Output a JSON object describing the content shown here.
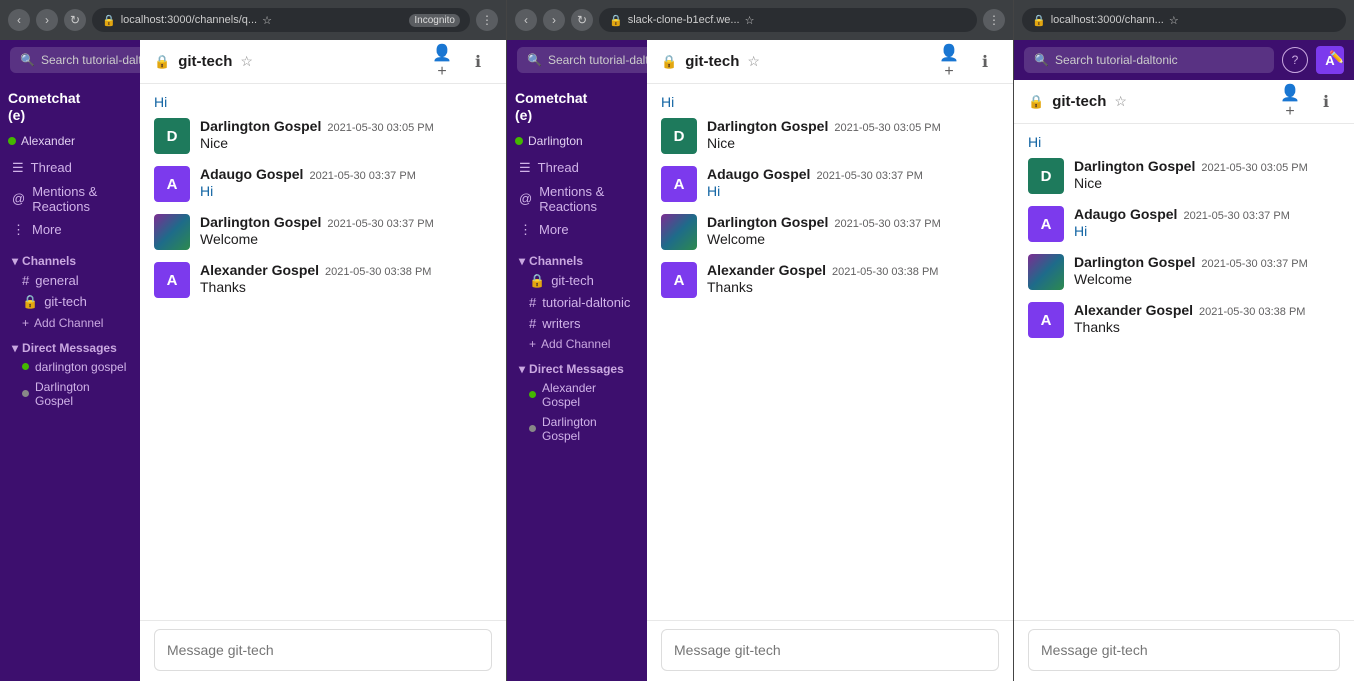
{
  "browsers": [
    {
      "id": "browser1",
      "address": "localhost:3000/channels/q...",
      "badge": "Incognito",
      "app": {
        "brand": "Cometchat (e)",
        "user": "Alexander",
        "search_placeholder": "Search tutorial-daltonic",
        "channel_name": "git-tech",
        "sidebar": {
          "nav_items": [
            {
              "id": "thread",
              "label": "Thread",
              "icon": "☰"
            },
            {
              "id": "mentions",
              "label": "Mentions & Reactions",
              "icon": "@"
            },
            {
              "id": "more",
              "label": "More",
              "icon": "⋮"
            }
          ],
          "channels_section": "Channels",
          "channels": [
            {
              "id": "general",
              "label": "general",
              "icon": "#"
            },
            {
              "id": "git-tech",
              "label": "git-tech",
              "icon": "🔒"
            }
          ],
          "add_channel": "Add Channel",
          "dm_section": "Direct Messages",
          "dms": [
            {
              "id": "dm1",
              "label": "darlington gospel",
              "online": true
            },
            {
              "id": "dm2",
              "label": "Darlington Gospel",
              "online": false
            }
          ]
        },
        "messages": [
          {
            "id": "msg1",
            "avatar_type": "initial",
            "avatar_letter": "D",
            "avatar_color": "#1e7a5c",
            "name": "Darlington Gospel",
            "time": "2021-05-30 03:05 PM",
            "body": "Nice"
          },
          {
            "id": "msg2",
            "avatar_type": "initial",
            "avatar_letter": "A",
            "avatar_color": "#7c3aed",
            "name": "Adaugo Gospel",
            "time": "2021-05-30 03:37 PM",
            "body": "Hi",
            "body_blue": true
          },
          {
            "id": "msg3",
            "avatar_type": "image",
            "name": "Darlington Gospel",
            "time": "2021-05-30 03:37 PM",
            "body": "Welcome"
          },
          {
            "id": "msg4",
            "avatar_type": "initial",
            "avatar_letter": "A",
            "avatar_color": "#7c3aed",
            "name": "Alexander Gospel",
            "time": "2021-05-30 03:38 PM",
            "body": "Thanks"
          }
        ],
        "message_input_placeholder": "Message git-tech",
        "hi_greeting": "Hi"
      }
    },
    {
      "id": "browser2",
      "address": "slack-clone-b1ecf.we...",
      "badge": "",
      "app": {
        "brand": "Cometchat (e)",
        "user": "Darlington",
        "search_placeholder": "Search tutorial-daltonic",
        "channel_name": "git-tech",
        "sidebar": {
          "nav_items": [
            {
              "id": "thread",
              "label": "Thread",
              "icon": "☰"
            },
            {
              "id": "mentions",
              "label": "Mentions & Reactions",
              "icon": "@"
            },
            {
              "id": "more",
              "label": "More",
              "icon": "⋮"
            }
          ],
          "channels_section": "Channels",
          "channels": [
            {
              "id": "git-tech-locked",
              "label": "git-tech",
              "icon": "🔒"
            },
            {
              "id": "tutorial-daltonic",
              "label": "tutorial-daltonic",
              "icon": "#"
            },
            {
              "id": "writers",
              "label": "writers",
              "icon": "#"
            }
          ],
          "add_channel": "Add Channel",
          "dm_section": "Direct Messages",
          "dms": [
            {
              "id": "dm1",
              "label": "Alexander Gospel",
              "online": true
            },
            {
              "id": "dm2",
              "label": "Darlington Gospel",
              "online": false
            }
          ]
        }
      }
    }
  ],
  "third_panel": {
    "address": "localhost:3000/chann...",
    "search_placeholder": "Search tutorial-daltonic",
    "channel_name": "git-tech",
    "messages": [
      {
        "id": "msg1",
        "avatar_letter": "D",
        "avatar_color": "#1e7a5c",
        "name": "Darlington Gospel",
        "time": "2021-05-30 03:05 PM",
        "body": "Nice"
      },
      {
        "id": "msg2",
        "avatar_letter": "A",
        "avatar_color": "#7c3aed",
        "name": "Adaugo Gospel",
        "time": "2021-05-30 03:37 PM",
        "body": "Hi",
        "body_blue": true
      },
      {
        "id": "msg3",
        "avatar_type": "image",
        "name": "Darlington Gospel",
        "time": "2021-05-30 03:37 PM",
        "body": "Welcome"
      },
      {
        "id": "msg4",
        "avatar_letter": "A",
        "avatar_color": "#7c3aed",
        "name": "Alexander Gospel",
        "time": "2021-05-30 03:38 PM",
        "body": "Thanks"
      }
    ],
    "message_input_placeholder": "Message git-tech"
  },
  "labels": {
    "thread": "Thread",
    "mentions_reactions": "Mentions & Reactions",
    "more": "More",
    "channels": "Channels",
    "general": "general",
    "git_tech": "git-tech",
    "tutorial_daltonic": "tutorial-daltonic",
    "writers": "writers",
    "add_channel": "Add Channel",
    "direct_messages": "Direct Messages",
    "alexander_gospel": "Alexander Gospel",
    "adaugo_gospel": "Adaugo Gospel",
    "darlington_gospel": "Darlington Gospel",
    "darlington_gospel_lower": "darlington gospel",
    "cometchat": "Cometchat",
    "cometchat_sub": "(e)",
    "alexander": "Alexander",
    "darlington": "Darlington",
    "msg_time1": "2021-05-30 03:05 PM",
    "msg_time2": "2021-05-30 03:37 PM",
    "msg_time3": "2021-05-30 03:37 PM",
    "msg_time4": "2021-05-30 03:38 PM",
    "nice": "Nice",
    "hi": "Hi",
    "welcome": "Welcome",
    "thanks": "Thanks",
    "msg_git_tech": "Message git-tech"
  }
}
